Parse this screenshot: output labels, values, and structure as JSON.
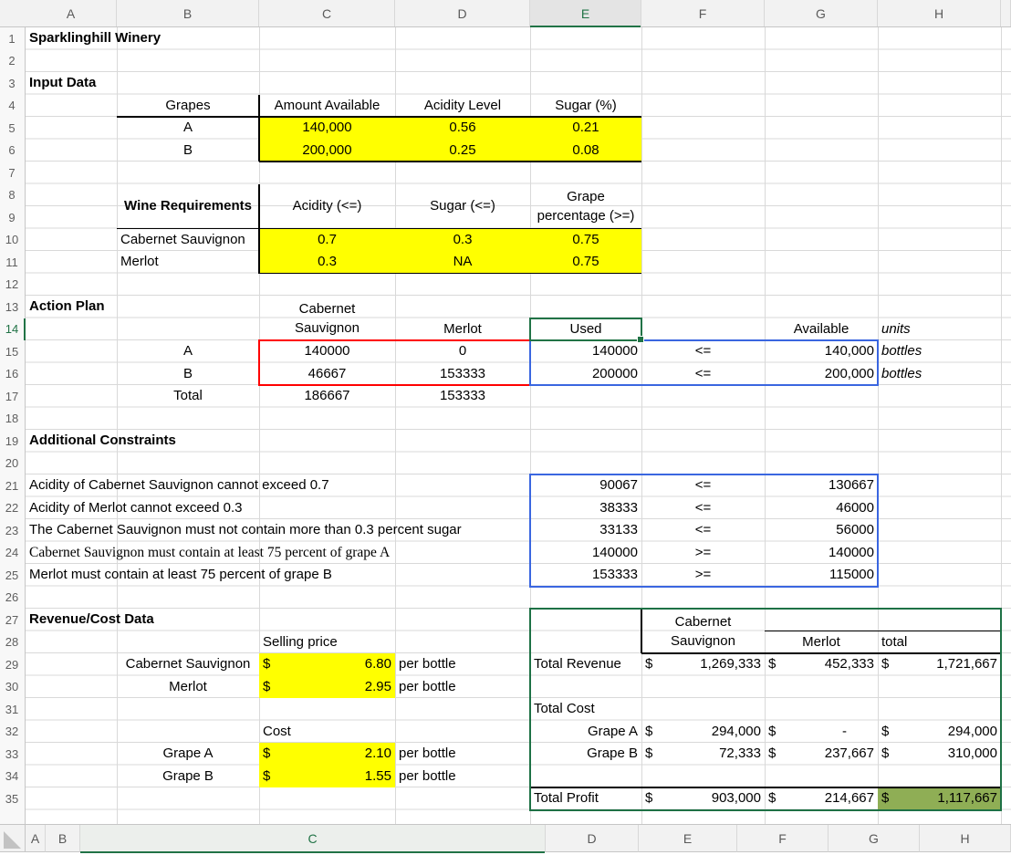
{
  "colors": {
    "highlight_yellow": "#FFFF00",
    "profit_green_fill": "#8FAE55",
    "box_red": "#FF0000",
    "box_blue": "#3A66E0",
    "box_green": "#1E7145",
    "selection_green": "#217346"
  },
  "main_header": {
    "columns": [
      "A",
      "B",
      "C",
      "D",
      "E",
      "F",
      "G",
      "H"
    ],
    "selected": "E"
  },
  "rows": {
    "first": 1,
    "last": 35,
    "selected": 14
  },
  "bottom_header": {
    "columns": [
      "A",
      "B",
      "C",
      "D",
      "E",
      "F",
      "G",
      "H"
    ],
    "selected": "C"
  },
  "selection": {
    "cell": "E14"
  },
  "annotation_boxes": [
    {
      "range": "C15:D16",
      "color": "#FF0000",
      "name": "decision-variables-box"
    },
    {
      "range": "E15:G16",
      "color": "#3A66E0",
      "name": "grape-usage-box"
    },
    {
      "range": "E21:G25",
      "color": "#3A66E0",
      "name": "additional-constraints-box"
    },
    {
      "range": "E27:H35",
      "color": "#1E7145",
      "name": "revenue-cost-box"
    }
  ],
  "cells": [
    {
      "r": 1,
      "c": "A",
      "t": "Sparklinghill Winery",
      "b": 1
    },
    {
      "r": 3,
      "c": "A",
      "t": "Input Data",
      "b": 1
    },
    {
      "r": 4,
      "c": "B",
      "t": "Grapes",
      "al": "c"
    },
    {
      "r": 4,
      "c": "C",
      "t": "Amount Available",
      "al": "c"
    },
    {
      "r": 4,
      "c": "D",
      "t": "Acidity Level",
      "al": "c"
    },
    {
      "r": 4,
      "c": "E",
      "t": "Sugar (%)",
      "al": "c"
    },
    {
      "r": 5,
      "c": "B",
      "t": "A",
      "al": "c"
    },
    {
      "r": 5,
      "c": "C",
      "t": "140,000",
      "al": "c",
      "f": "y"
    },
    {
      "r": 5,
      "c": "D",
      "t": "0.56",
      "al": "c",
      "f": "y"
    },
    {
      "r": 5,
      "c": "E",
      "t": "0.21",
      "al": "c",
      "f": "y"
    },
    {
      "r": 6,
      "c": "B",
      "t": "B",
      "al": "c"
    },
    {
      "r": 6,
      "c": "C",
      "t": "200,000",
      "al": "c",
      "f": "y"
    },
    {
      "r": 6,
      "c": "D",
      "t": "0.25",
      "al": "c",
      "f": "y"
    },
    {
      "r": 6,
      "c": "E",
      "t": "0.08",
      "al": "c",
      "f": "y"
    },
    {
      "r": 8,
      "c": "B",
      "t": "Wine Requirements",
      "b": 1,
      "rs": 2,
      "al": "c"
    },
    {
      "r": 8,
      "c": "C",
      "t": "Acidity (<=)",
      "rs": 2,
      "al": "c"
    },
    {
      "r": 8,
      "c": "D",
      "t": "Sugar (<=)",
      "rs": 2,
      "al": "c"
    },
    {
      "r": 8,
      "c": "E",
      "t": "Grape\npercentage (>=)",
      "rs": 2,
      "al": "c",
      "wrap": 1
    },
    {
      "r": 10,
      "c": "B",
      "t": "Cabernet Sauvignon"
    },
    {
      "r": 10,
      "c": "C",
      "t": "0.7",
      "al": "c",
      "f": "y"
    },
    {
      "r": 10,
      "c": "D",
      "t": "0.3",
      "al": "c",
      "f": "y"
    },
    {
      "r": 10,
      "c": "E",
      "t": "0.75",
      "al": "c",
      "f": "y"
    },
    {
      "r": 11,
      "c": "B",
      "t": "Merlot"
    },
    {
      "r": 11,
      "c": "C",
      "t": "0.3",
      "al": "c",
      "f": "y"
    },
    {
      "r": 11,
      "c": "D",
      "t": "NA",
      "al": "c",
      "f": "y"
    },
    {
      "r": 11,
      "c": "E",
      "t": "0.75",
      "al": "c",
      "f": "y"
    },
    {
      "r": 13,
      "c": "A",
      "t": "Action Plan",
      "b": 1
    },
    {
      "r": 13,
      "c": "C",
      "t": "Cabernet\nSauvignon",
      "rs": 2,
      "al": "c",
      "wrap": 1
    },
    {
      "r": 14,
      "c": "D",
      "t": "Merlot",
      "al": "c"
    },
    {
      "r": 14,
      "c": "E",
      "t": "Used",
      "al": "c"
    },
    {
      "r": 14,
      "c": "G",
      "t": "Available",
      "al": "c"
    },
    {
      "r": 14,
      "c": "H",
      "t": "units",
      "i": 1
    },
    {
      "r": 15,
      "c": "B",
      "t": "A",
      "al": "c"
    },
    {
      "r": 15,
      "c": "C",
      "t": "140000",
      "al": "c"
    },
    {
      "r": 15,
      "c": "D",
      "t": "0",
      "al": "c"
    },
    {
      "r": 15,
      "c": "E",
      "t": "140000",
      "al": "r"
    },
    {
      "r": 15,
      "c": "F",
      "t": "<=",
      "al": "c"
    },
    {
      "r": 15,
      "c": "G",
      "t": "140,000",
      "al": "r"
    },
    {
      "r": 15,
      "c": "H",
      "t": "bottles",
      "i": 1
    },
    {
      "r": 16,
      "c": "B",
      "t": "B",
      "al": "c"
    },
    {
      "r": 16,
      "c": "C",
      "t": "46667",
      "al": "c"
    },
    {
      "r": 16,
      "c": "D",
      "t": "153333",
      "al": "c"
    },
    {
      "r": 16,
      "c": "E",
      "t": "200000",
      "al": "r"
    },
    {
      "r": 16,
      "c": "F",
      "t": "<=",
      "al": "c"
    },
    {
      "r": 16,
      "c": "G",
      "t": "200,000",
      "al": "r"
    },
    {
      "r": 16,
      "c": "H",
      "t": "bottles",
      "i": 1
    },
    {
      "r": 17,
      "c": "B",
      "t": "Total",
      "al": "c"
    },
    {
      "r": 17,
      "c": "C",
      "t": "186667",
      "al": "c"
    },
    {
      "r": 17,
      "c": "D",
      "t": "153333",
      "al": "c"
    },
    {
      "r": 19,
      "c": "A",
      "t": "Additional Constraints",
      "b": 1
    },
    {
      "r": 21,
      "c": "A",
      "t": "Acidity of Cabernet Sauvignon cannot exceed 0.7"
    },
    {
      "r": 21,
      "c": "E",
      "t": "90067",
      "al": "r"
    },
    {
      "r": 21,
      "c": "F",
      "t": "<=",
      "al": "c"
    },
    {
      "r": 21,
      "c": "G",
      "t": "130667",
      "al": "r"
    },
    {
      "r": 22,
      "c": "A",
      "t": "Acidity of Merlot cannot exceed 0.3"
    },
    {
      "r": 22,
      "c": "E",
      "t": "38333",
      "al": "r"
    },
    {
      "r": 22,
      "c": "F",
      "t": "<=",
      "al": "c"
    },
    {
      "r": 22,
      "c": "G",
      "t": "46000",
      "al": "r"
    },
    {
      "r": 23,
      "c": "A",
      "t": "The Cabernet Sauvignon must not contain more than 0.3 percent sugar"
    },
    {
      "r": 23,
      "c": "E",
      "t": "33133",
      "al": "r"
    },
    {
      "r": 23,
      "c": "F",
      "t": "<=",
      "al": "c"
    },
    {
      "r": 23,
      "c": "G",
      "t": "56000",
      "al": "r"
    },
    {
      "r": 24,
      "c": "A",
      "t": "Cabernet Sauvignon must contain at least 75 percent of grape A",
      "serif": 1
    },
    {
      "r": 24,
      "c": "E",
      "t": "140000",
      "al": "r"
    },
    {
      "r": 24,
      "c": "F",
      "t": ">=",
      "al": "c"
    },
    {
      "r": 24,
      "c": "G",
      "t": "140000",
      "al": "r"
    },
    {
      "r": 25,
      "c": "A",
      "t": "Merlot must contain at least 75 percent of grape B"
    },
    {
      "r": 25,
      "c": "E",
      "t": "153333",
      "al": "r"
    },
    {
      "r": 25,
      "c": "F",
      "t": ">=",
      "al": "c"
    },
    {
      "r": 25,
      "c": "G",
      "t": "115000",
      "al": "r"
    },
    {
      "r": 27,
      "c": "A",
      "t": "Revenue/Cost Data",
      "b": 1
    },
    {
      "r": 27,
      "c": "F",
      "t": "Cabernet\nSauvignon",
      "rs": 2,
      "al": "c",
      "wrap": 1
    },
    {
      "r": 28,
      "c": "C",
      "t": "Selling price"
    },
    {
      "r": 28,
      "c": "G",
      "t": "Merlot",
      "al": "c"
    },
    {
      "r": 28,
      "c": "H",
      "t": "total"
    },
    {
      "r": 29,
      "c": "B",
      "t": "Cabernet Sauvignon",
      "al": "c"
    },
    {
      "r": 29,
      "c": "C",
      "cur": "$",
      "t": "6.80",
      "f": "y"
    },
    {
      "r": 29,
      "c": "D",
      "t": "per bottle"
    },
    {
      "r": 29,
      "c": "E",
      "t": "Total Revenue"
    },
    {
      "r": 29,
      "c": "F",
      "cur": "$",
      "t": "1,269,333"
    },
    {
      "r": 29,
      "c": "G",
      "cur": "$",
      "t": "452,333"
    },
    {
      "r": 29,
      "c": "H",
      "cur": "$",
      "t": "1,721,667"
    },
    {
      "r": 30,
      "c": "B",
      "t": "Merlot",
      "al": "c"
    },
    {
      "r": 30,
      "c": "C",
      "cur": "$",
      "t": "2.95",
      "f": "y"
    },
    {
      "r": 30,
      "c": "D",
      "t": "per bottle"
    },
    {
      "r": 31,
      "c": "E",
      "t": "Total Cost"
    },
    {
      "r": 32,
      "c": "C",
      "t": "Cost"
    },
    {
      "r": 32,
      "c": "E",
      "t": "Grape A",
      "al": "r"
    },
    {
      "r": 32,
      "c": "F",
      "cur": "$",
      "t": "294,000"
    },
    {
      "r": 32,
      "c": "G",
      "cur": "$",
      "t": "-"
    },
    {
      "r": 32,
      "c": "H",
      "cur": "$",
      "t": "294,000"
    },
    {
      "r": 33,
      "c": "B",
      "t": "Grape A",
      "al": "c"
    },
    {
      "r": 33,
      "c": "C",
      "cur": "$",
      "t": "2.10",
      "f": "y"
    },
    {
      "r": 33,
      "c": "D",
      "t": "per bottle"
    },
    {
      "r": 33,
      "c": "E",
      "t": "Grape B",
      "al": "r"
    },
    {
      "r": 33,
      "c": "F",
      "cur": "$",
      "t": "72,333"
    },
    {
      "r": 33,
      "c": "G",
      "cur": "$",
      "t": "237,667"
    },
    {
      "r": 33,
      "c": "H",
      "cur": "$",
      "t": "310,000"
    },
    {
      "r": 34,
      "c": "B",
      "t": "Grape B",
      "al": "c"
    },
    {
      "r": 34,
      "c": "C",
      "cur": "$",
      "t": "1.55",
      "f": "y"
    },
    {
      "r": 34,
      "c": "D",
      "t": "per bottle"
    },
    {
      "r": 35,
      "c": "E",
      "t": "Total Profit"
    },
    {
      "r": 35,
      "c": "F",
      "cur": "$",
      "t": "903,000"
    },
    {
      "r": 35,
      "c": "G",
      "cur": "$",
      "t": "214,667"
    },
    {
      "r": 35,
      "c": "H",
      "cur": "$",
      "t": "1,117,667",
      "f": "g"
    }
  ]
}
